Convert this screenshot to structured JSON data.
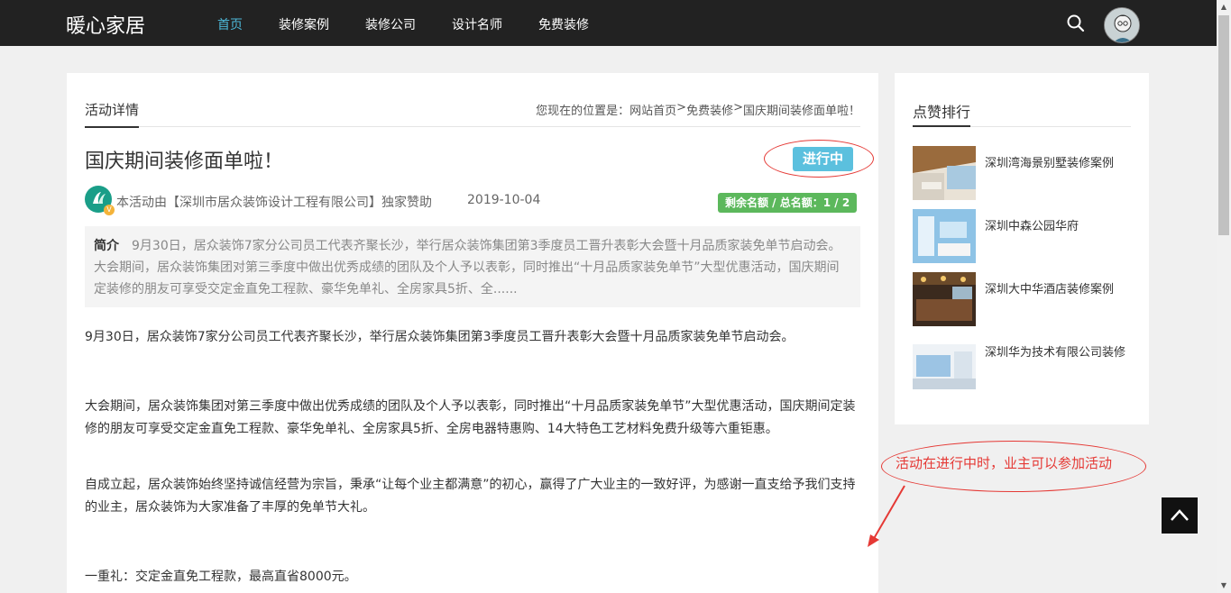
{
  "header": {
    "logo": "暖心家居",
    "nav": [
      "首页",
      "装修案例",
      "装修公司",
      "设计名师",
      "免费装修"
    ],
    "active_index": 0,
    "icons": {
      "search": "search-icon",
      "avatar": "user-avatar"
    }
  },
  "main": {
    "section_label": "活动详情",
    "breadcrumb_prefix": "您现在的位置是：",
    "breadcrumb": [
      "网站首页",
      "免费装修",
      "国庆期间装修面单啦！"
    ],
    "title": "国庆期间装修面单啦！",
    "status": "进行中",
    "sponsor": "本活动由【深圳市居众装饰设计工程有限公司】独家赞助",
    "date": "2019-10-04",
    "quota_text": "剩余名额 / 总名额：1 / 2",
    "intro_label": "简介",
    "intro": "9月30日，居众装饰7家分公司员工代表齐聚长沙，举行居众装饰集团第3季度员工晋升表彰大会暨十月品质家装免单节启动会。大会期间，居众装饰集团对第三季度中做出优秀成绩的团队及个人予以表彰，同时推出“十月品质家装免单节”大型优惠活动，国庆期间定装修的朋友可享受交定金直免工程款、豪华免单礼、全房家具5折、全......",
    "paragraphs": [
      "9月30日，居众装饰7家分公司员工代表齐聚长沙，举行居众装饰集团第3季度员工晋升表彰大会暨十月品质家装免单节启动会。",
      "大会期间，居众装饰集团对第三季度中做出优秀成绩的团队及个人予以表彰，同时推出“十月品质家装免单节”大型优惠活动，国庆期间定装修的朋友可享受交定金直免工程款、豪华免单礼、全房家具5折、全房电器特惠购、14大特色工艺材料免费升级等六重钜惠。",
      "自成立起，居众装饰始终坚持诚信经营为宗旨，秉承“让每个业主都满意”的初心，赢得了广大业主的一致好评，为感谢一直支给予我们支持的业主，居众装饰为大家准备了丰厚的免单节大礼。",
      "一重礼：交定金直免工程款，最高直省8000元。"
    ]
  },
  "sidebar": {
    "title": "点赞排行",
    "items": [
      {
        "label": "深圳湾海景别墅装修案例"
      },
      {
        "label": "深圳中森公园华府"
      },
      {
        "label": "深圳大中华酒店装修案例"
      },
      {
        "label": "深圳华为技术有限公司装修"
      }
    ]
  },
  "annotation": {
    "text": "活动在进行中时，业主可以参加活动"
  },
  "colors": {
    "topbar": "#222222",
    "nav_active": "#4db8d8",
    "status_badge": "#5bc0de",
    "quota_badge": "#5cb85c",
    "annotation_red": "#e53935"
  }
}
